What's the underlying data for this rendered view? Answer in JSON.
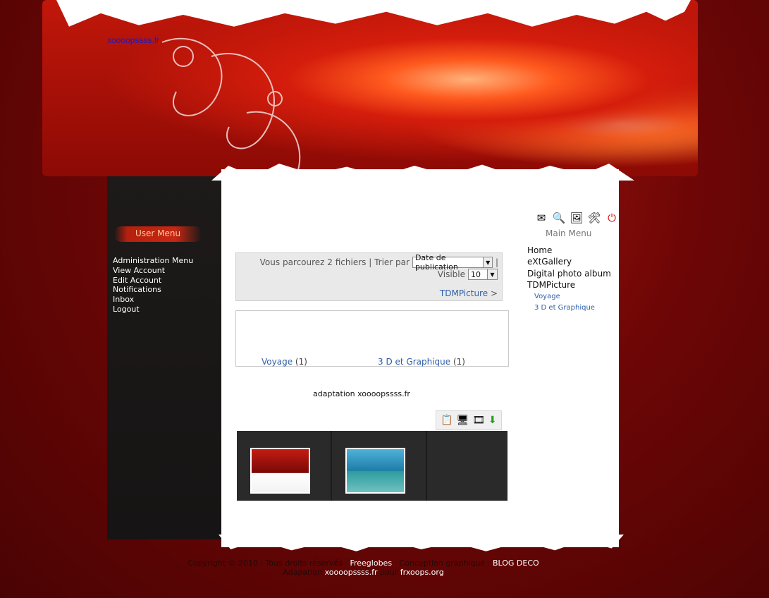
{
  "site": {
    "link_text": "xoooopssss.fr"
  },
  "user_menu": {
    "title": "User Menu",
    "items": [
      {
        "label": "Administration Menu"
      },
      {
        "label": "View Account"
      },
      {
        "label": "Edit Account"
      },
      {
        "label": "Notifications"
      },
      {
        "label": "Inbox"
      },
      {
        "label": "Logout"
      }
    ]
  },
  "toolbar": {
    "icons": [
      "envelope-icon",
      "search-icon",
      "pictures-icon",
      "tools-icon",
      "power-icon"
    ]
  },
  "main_menu": {
    "title": "Main Menu",
    "items": [
      {
        "label": "Home"
      },
      {
        "label": "eXtGallery"
      },
      {
        "label": "Digital photo album"
      },
      {
        "label": "TDMPicture"
      },
      {
        "label": "Voyage",
        "sub": true
      },
      {
        "label": "3 D et Graphique",
        "sub": true
      }
    ]
  },
  "browse": {
    "count_text": "Vous parcourez 2 fichiers | Trier par",
    "sort_value": "Date de publication",
    "separator": "|",
    "visible_label": "Visible",
    "visible_value": "10",
    "breadcrumb_link": "TDMPicture",
    "breadcrumb_suffix": ">"
  },
  "categories": [
    {
      "label": "Voyage",
      "count": "(1)"
    },
    {
      "label": "3 D et Graphique",
      "count": "(1)"
    }
  ],
  "adaptation_text": "adaptation xoooopssss.fr",
  "gallery_tools": [
    "list-view-icon",
    "monitor-icon",
    "slideshow-icon",
    "download-arrow-icon"
  ],
  "footer": {
    "line1_part1": "Copyright © 2010 · Tous droits réservés · ",
    "line1_link1": "Freeglobes",
    "line1_part2": " · Conception graphique : ",
    "line1_link2": "BLOG DECO",
    "line2_part1": "Adapation ",
    "line2_link1": "xoooopssss.fr",
    "line2_part2": " pour ",
    "line2_link2": "frxoops.org"
  }
}
